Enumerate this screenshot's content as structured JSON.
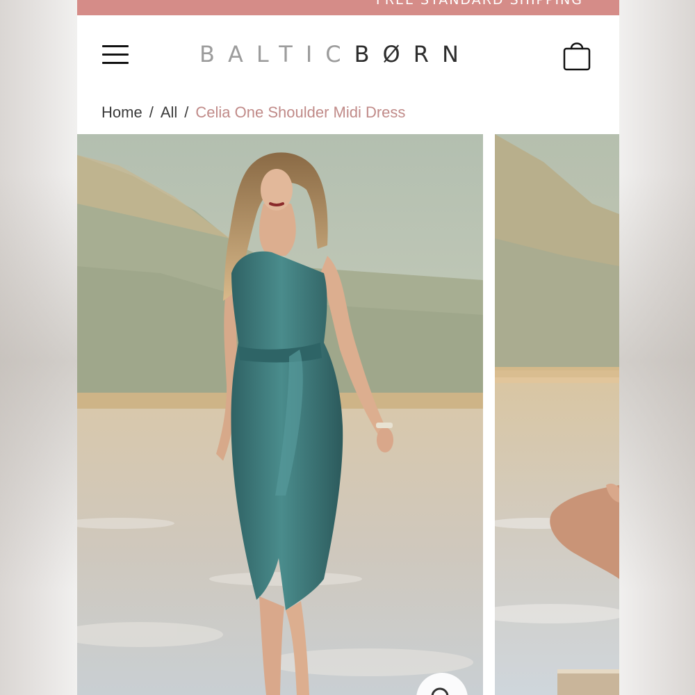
{
  "promo": {
    "text": "FREE STANDARD SHIPPING"
  },
  "header": {
    "brand_light": "BALTIC",
    "brand_dark": "BØRN",
    "menu_icon": "hamburger-menu-icon",
    "cart_icon": "shopping-bag-icon"
  },
  "breadcrumb": {
    "items": [
      "Home",
      "All"
    ],
    "separator": "/",
    "current": "Celia One Shoulder Midi Dress"
  },
  "gallery": {
    "images": [
      "model-in-teal-satin-dress-desert",
      "model-crouching-desert"
    ],
    "zoom_icon": "magnifier-icon"
  },
  "colors": {
    "promo_bar": "#d58c88",
    "breadcrumb_current": "#c08a88",
    "dress_teal": "#3f7878"
  }
}
